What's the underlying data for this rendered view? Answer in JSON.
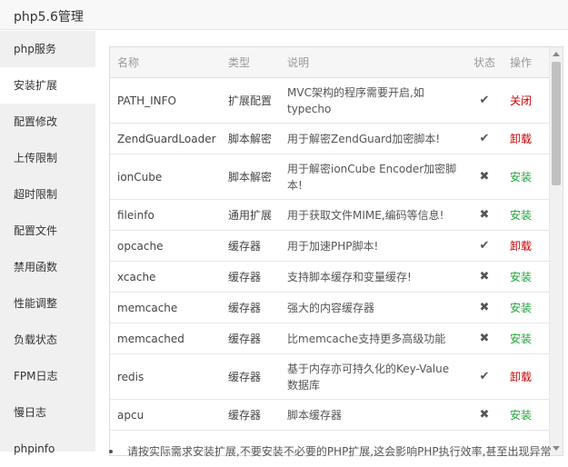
{
  "window": {
    "title": "php5.6管理"
  },
  "sidebar": {
    "items": [
      {
        "label": "php服务"
      },
      {
        "label": "安装扩展"
      },
      {
        "label": "配置修改"
      },
      {
        "label": "上传限制"
      },
      {
        "label": "超时限制"
      },
      {
        "label": "配置文件"
      },
      {
        "label": "禁用函数"
      },
      {
        "label": "性能调整"
      },
      {
        "label": "负载状态"
      },
      {
        "label": "FPM日志"
      },
      {
        "label": "慢日志"
      },
      {
        "label": "phpinfo"
      }
    ],
    "active": "安装扩展"
  },
  "table": {
    "headers": {
      "name": "名称",
      "type": "类型",
      "desc": "说明",
      "status": "状态",
      "op": "操作"
    },
    "rows": [
      {
        "name": "PATH_INFO",
        "type": "扩展配置",
        "desc": "MVC架构的程序需要开启,如typecho",
        "status": "✔",
        "op": "关闭",
        "op_color": "#cc0000"
      },
      {
        "name": "ZendGuardLoader",
        "type": "脚本解密",
        "desc": "用于解密ZendGuard加密脚本!",
        "status": "✔",
        "op": "卸载",
        "op_color": "#cc0000"
      },
      {
        "name": "ionCube",
        "type": "脚本解密",
        "desc": "用于解密ionCube Encoder加密脚本!",
        "status": "✖",
        "op": "安装",
        "op_color": "#20a53a"
      },
      {
        "name": "fileinfo",
        "type": "通用扩展",
        "desc": "用于获取文件MIME,编码等信息!",
        "status": "✖",
        "op": "安装",
        "op_color": "#20a53a"
      },
      {
        "name": "opcache",
        "type": "缓存器",
        "desc": "用于加速PHP脚本!",
        "status": "✔",
        "op": "卸载",
        "op_color": "#cc0000"
      },
      {
        "name": "xcache",
        "type": "缓存器",
        "desc": "支持脚本缓存和变量缓存!",
        "status": "✖",
        "op": "安装",
        "op_color": "#20a53a"
      },
      {
        "name": "memcache",
        "type": "缓存器",
        "desc": "强大的内容缓存器",
        "status": "✖",
        "op": "安装",
        "op_color": "#20a53a"
      },
      {
        "name": "memcached",
        "type": "缓存器",
        "desc": "比memcache支持更多高级功能",
        "status": "✖",
        "op": "安装",
        "op_color": "#20a53a"
      },
      {
        "name": "redis",
        "type": "缓存器",
        "desc": "基于内存亦可持久化的Key-Value数据库",
        "status": "✔",
        "op": "卸载",
        "op_color": "#cc0000"
      },
      {
        "name": "apcu",
        "type": "缓存器",
        "desc": "脚本缓存器",
        "status": "✖",
        "op": "安装",
        "op_color": "#20a53a"
      }
    ]
  },
  "note": "请按实际需求安装扩展,不要安装不必要的PHP扩展,这会影响PHP执行效率,甚至出现异常"
}
